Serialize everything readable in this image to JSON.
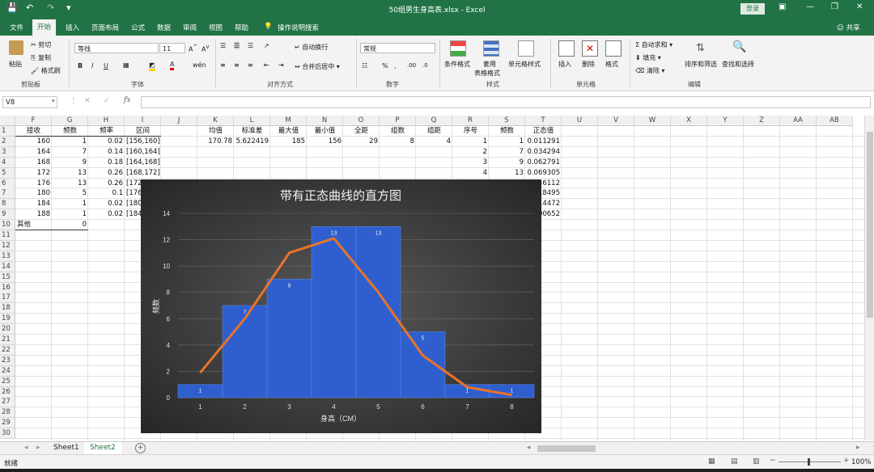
{
  "window": {
    "title": "50组男生身高表.xlsx - Excel",
    "login_label": "登录",
    "share_label": "共享"
  },
  "ribbon_tabs": [
    "文件",
    "开始",
    "插入",
    "页面布局",
    "公式",
    "数据",
    "审阅",
    "视图",
    "帮助"
  ],
  "tell_me": "操作说明搜索",
  "ribbon": {
    "clipboard": {
      "paste": "粘贴",
      "cut": "剪切",
      "copy": "复制",
      "format_painter": "格式刷",
      "group": "剪贴板"
    },
    "font": {
      "name": "等线",
      "size": "11",
      "group": "字体"
    },
    "alignment": {
      "wrap": "自动换行",
      "merge": "合并后居中",
      "group": "对齐方式"
    },
    "number": {
      "format": "常规",
      "group": "数字"
    },
    "styles": {
      "conditional": "条件格式",
      "table1": "套用",
      "table2": "表格格式",
      "cell_styles": "单元格样式",
      "group": "样式"
    },
    "cells": {
      "insert": "插入",
      "delete": "删除",
      "format": "格式",
      "group": "单元格"
    },
    "editing": {
      "autosum": "自动求和",
      "fill": "填充",
      "clear": "清除",
      "sort": "排序和筛选",
      "find": "查找和选择",
      "group": "编辑"
    }
  },
  "formula_bar": {
    "name_box": "V8",
    "fx": "fx",
    "content": ""
  },
  "columns": [
    "F",
    "G",
    "H",
    "I",
    "J",
    "K",
    "L",
    "M",
    "N",
    "O",
    "P",
    "Q",
    "R",
    "S",
    "T",
    "U",
    "V",
    "W",
    "X",
    "Y",
    "Z",
    "AA",
    "AB"
  ],
  "rows": [
    "1",
    "2",
    "3",
    "4",
    "5",
    "6",
    "7",
    "8",
    "9",
    "10",
    "11",
    "12",
    "13",
    "14",
    "15",
    "16",
    "17",
    "18",
    "19",
    "20",
    "21",
    "22",
    "23",
    "24",
    "25",
    "26",
    "27",
    "28",
    "29",
    "30"
  ],
  "cells": {
    "F1": "接收",
    "G1": "频数",
    "H1": "频率",
    "I1": "区间",
    "K1": "均值",
    "L1": "标准差",
    "M1": "最大值",
    "N1": "最小值",
    "O1": "全距",
    "P1": "组数",
    "Q1": "组距",
    "R1": "序号",
    "S1": "频数",
    "T1": "正态值",
    "F2": "160",
    "G2": "1",
    "H2": "0.02",
    "I2": "[156,160]",
    "K2": "170.78",
    "L2": "5.622419",
    "M2": "185",
    "N2": "156",
    "O2": "29",
    "P2": "8",
    "Q2": "4",
    "R2": "1",
    "S2": "1",
    "T2": "0.011291",
    "F3": "164",
    "G3": "7",
    "H3": "0.14",
    "I3": "[160,164]",
    "R3": "2",
    "S3": "7",
    "T3": "0.034294",
    "F4": "168",
    "G4": "9",
    "H4": "0.18",
    "I4": "[164,168]",
    "R4": "3",
    "S4": "9",
    "T4": "0.062791",
    "F5": "172",
    "G5": "13",
    "H5": "0.26",
    "I5": "[168,172]",
    "R5": "4",
    "S5": "13",
    "T5": "0.069305",
    "F6": "176",
    "G6": "13",
    "H6": "0.26",
    "I6": "[172",
    "T6": "46112",
    "F7": "180",
    "G7": "5",
    "H7": "0.1",
    "I7": "[176",
    "T7": "18495",
    "F8": "184",
    "G8": "1",
    "H8": "0.02",
    "I8": "[180",
    "T8": "14472",
    "F9": "188",
    "G9": "1",
    "H9": "0.02",
    "I9": "[184",
    "T9": "00652",
    "F10": "其他",
    "G10": "0"
  },
  "chart_data": {
    "type": "bar",
    "title": "带有正态曲线的直方图",
    "xlabel": "身高（CM）",
    "ylabel": "频数",
    "categories": [
      "1",
      "2",
      "3",
      "4",
      "5",
      "6",
      "7",
      "8"
    ],
    "series": [
      {
        "kind": "bar",
        "values": [
          1,
          7,
          9,
          13,
          13,
          5,
          1,
          1
        ]
      },
      {
        "kind": "line",
        "values": [
          1.9,
          6.0,
          11.0,
          12.1,
          8.0,
          3.2,
          0.8,
          0.2
        ]
      }
    ],
    "data_labels": [
      "1",
      "7",
      "9",
      "13",
      "13",
      "5",
      "1",
      "1"
    ],
    "yticks": [
      "0",
      "2",
      "4",
      "6",
      "8",
      "10",
      "12",
      "14"
    ],
    "ylim": [
      0,
      14
    ],
    "colors": {
      "bar": "#2f5fcf",
      "line": "#e8742a"
    }
  },
  "sheet_tabs": [
    "Sheet1",
    "Sheet2"
  ],
  "active_sheet": "Sheet2",
  "status": {
    "ready": "就绪",
    "zoom": "100%"
  }
}
